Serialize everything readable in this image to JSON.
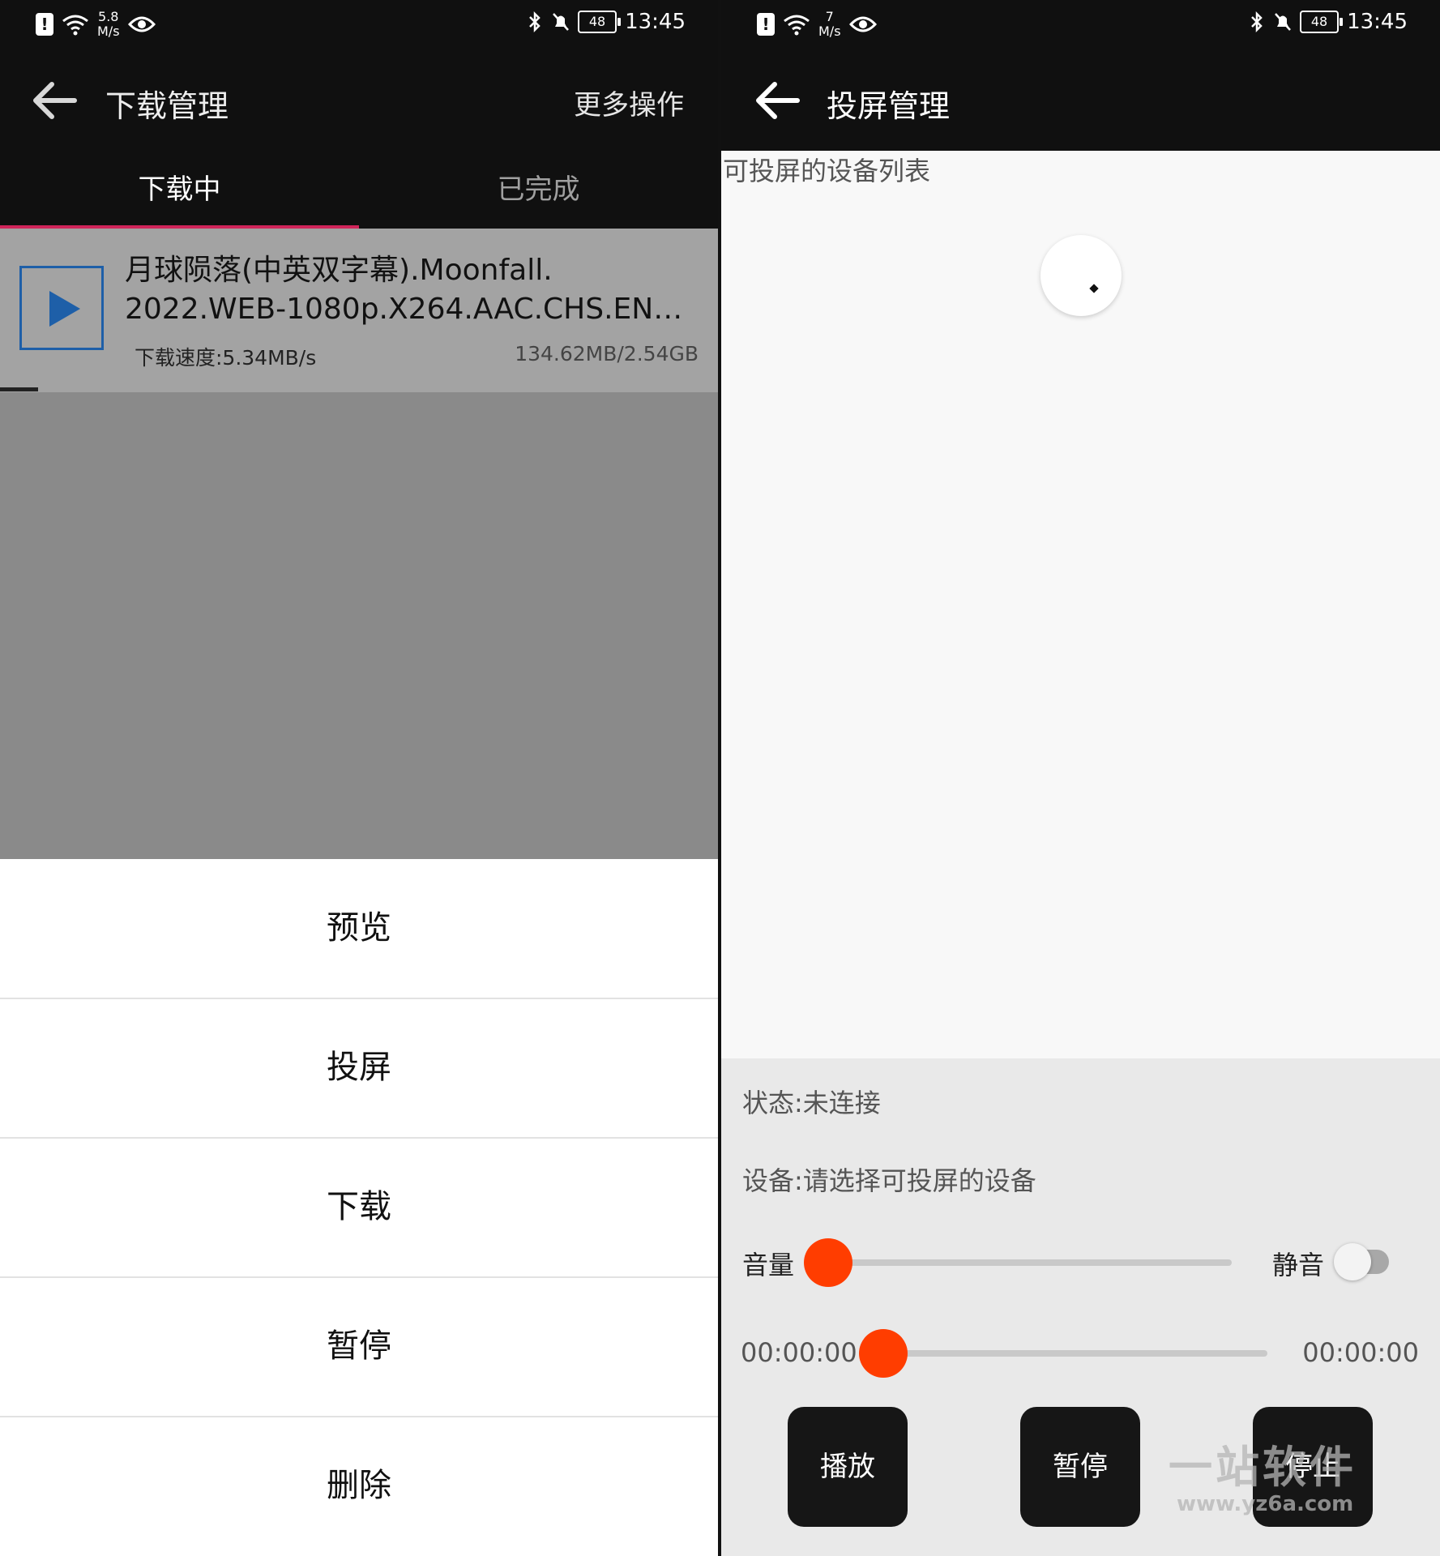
{
  "left": {
    "status": {
      "speed_value": "5.8",
      "speed_unit": "M/s",
      "battery": "48",
      "time": "13:45"
    },
    "appbar": {
      "title": "下载管理",
      "more": "更多操作"
    },
    "tabs": [
      {
        "label": "下载中"
      },
      {
        "label": "已完成"
      }
    ],
    "download": {
      "title": "月球陨落(中英双字幕).Moonfall.\n2022.WEB-1080p.X264.AAC.CHS.EN…",
      "speed": "下载速度:5.34MB/s",
      "size": "134.62MB/2.54GB",
      "progress": 0.053
    },
    "sheet": [
      {
        "label": "预览"
      },
      {
        "label": "投屏"
      },
      {
        "label": "下载"
      },
      {
        "label": "暂停"
      },
      {
        "label": "删除"
      }
    ]
  },
  "right": {
    "status": {
      "speed_value": "7",
      "speed_unit": "M/s",
      "battery": "48",
      "time": "13:45"
    },
    "appbar": {
      "title": "投屏管理"
    },
    "list_title": "可投屏的设备列表",
    "control": {
      "status": "状态:未连接",
      "device": "设备:请选择可投屏的设备",
      "volume_label": "音量",
      "volume_level": 0,
      "mute_label": "静音",
      "mute_on": false,
      "time_start": "00:00:00",
      "time_end": "00:00:00",
      "progress": 0,
      "buttons": [
        {
          "label": "播放"
        },
        {
          "label": "暂停"
        },
        {
          "label": "停止"
        }
      ]
    },
    "watermark": {
      "big": "一站软件",
      "small": "www.yz6a.com"
    }
  },
  "colors": {
    "accent": "#ff3d00",
    "tab_indicator": "#d0255a",
    "play_icon": "#1e5fa8",
    "bar": "#101010"
  }
}
